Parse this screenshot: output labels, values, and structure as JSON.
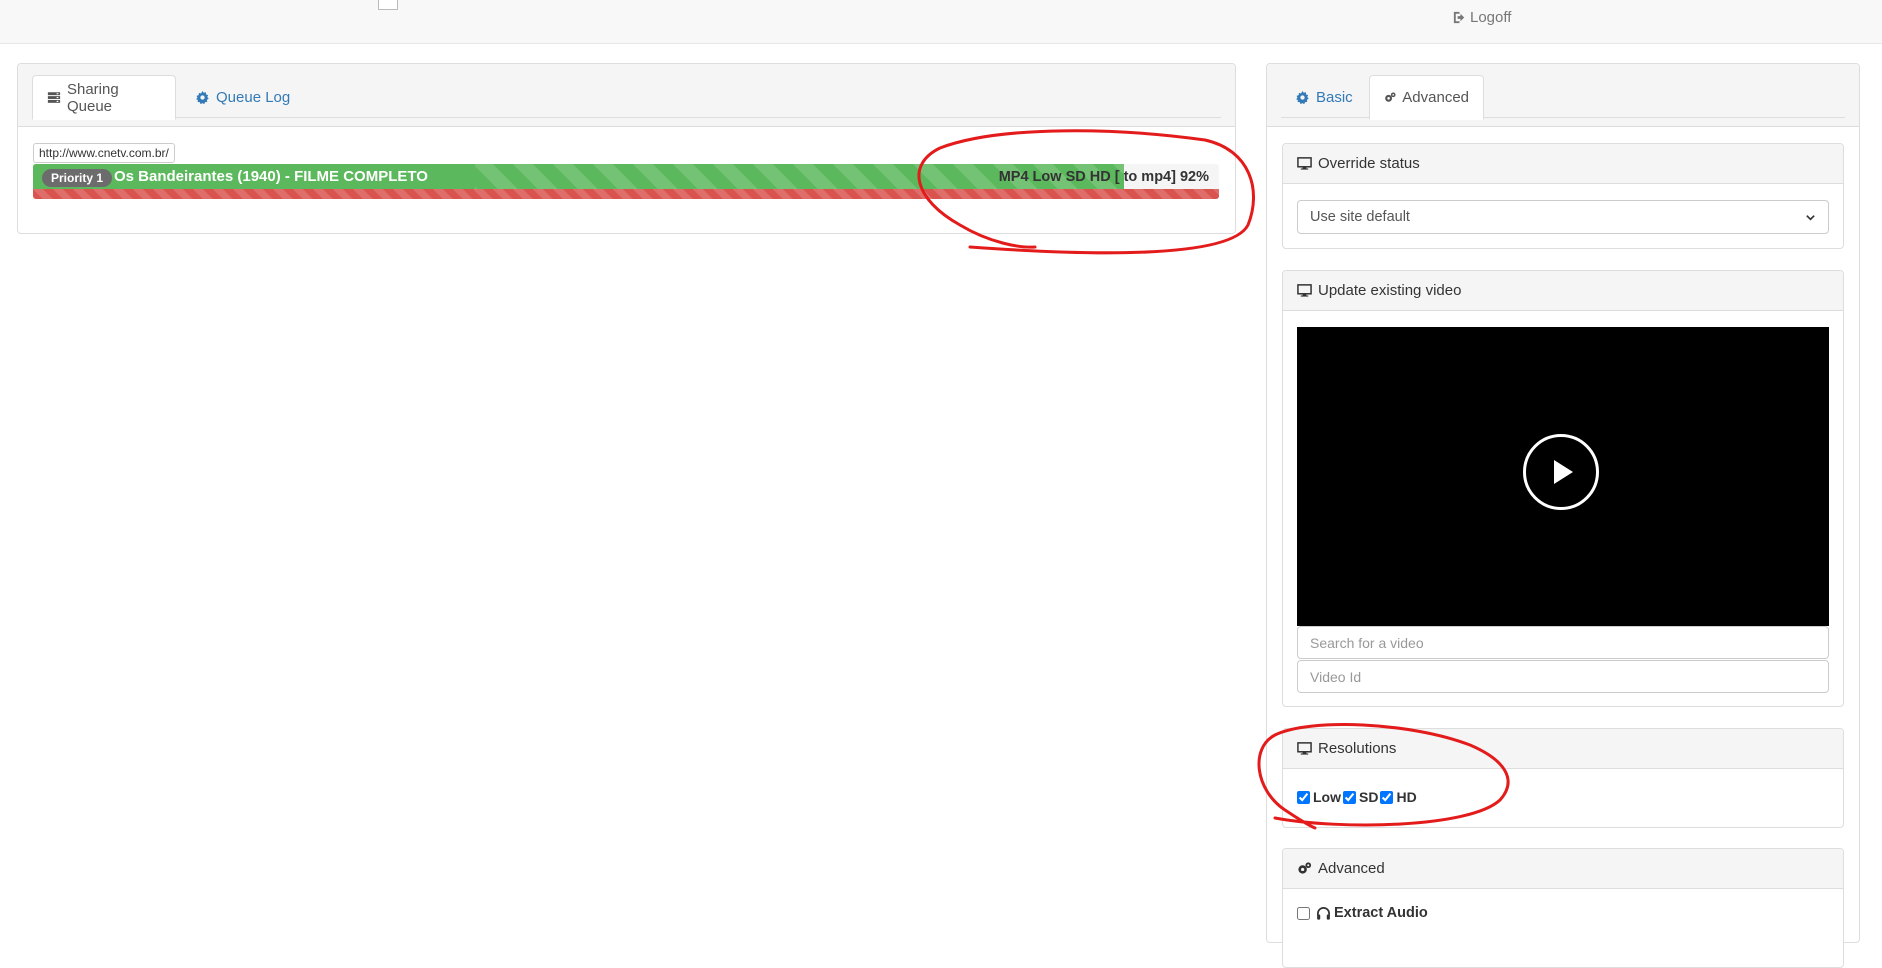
{
  "topbar": {
    "logoff_label": "Logoff"
  },
  "left_tabs": {
    "sharing_queue": "Sharing Queue",
    "queue_log": "Queue Log"
  },
  "queue_item": {
    "url": "http://www.cnetv.com.br/",
    "priority": "Priority 1",
    "title": "Os Bandeirantes (1940) - FILME COMPLETO",
    "status": "MP4 Low SD HD [ to mp4] 92%",
    "progress_percent": 92
  },
  "right_tabs": {
    "basic": "Basic",
    "advanced": "Advanced"
  },
  "override_status": {
    "heading": "Override status",
    "selected": "Use site default"
  },
  "update_video": {
    "heading": "Update existing video",
    "search_placeholder": "Search for a video",
    "video_id_placeholder": "Video Id"
  },
  "resolutions": {
    "heading": "Resolutions",
    "options": [
      {
        "label": "Low",
        "checked": true
      },
      {
        "label": "SD",
        "checked": true
      },
      {
        "label": "HD",
        "checked": true
      }
    ]
  },
  "advanced": {
    "heading": "Advanced",
    "extract_audio_label": "Extract Audio",
    "extract_audio_checked": false
  },
  "colors": {
    "link": "#337ab7",
    "progress_green": "#5cb85c",
    "progress_red": "#d9534f",
    "annotation": "#e31b1b"
  }
}
